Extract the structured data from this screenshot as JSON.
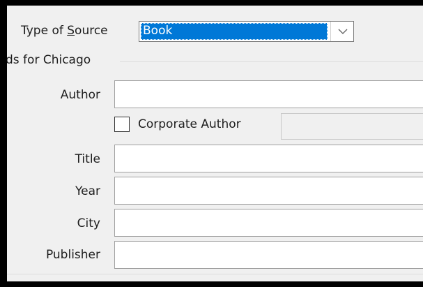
{
  "type_of_source": {
    "label_prefix": "Type of ",
    "label_mnemonic": "S",
    "label_suffix": "ource",
    "value": "Book"
  },
  "group": {
    "title": "ds for Chicago"
  },
  "fields": {
    "author": {
      "label": "Author",
      "value": ""
    },
    "corporate_author": {
      "label": "Corporate Author",
      "checked": false,
      "value": ""
    },
    "title": {
      "label": "Title",
      "value": ""
    },
    "year": {
      "label": "Year",
      "value": ""
    },
    "city": {
      "label": "City",
      "value": ""
    },
    "publisher": {
      "label": "Publisher",
      "value": ""
    }
  },
  "icons": {
    "dropdown": "chevron-down-icon"
  },
  "colors": {
    "selection": "#0078d7",
    "dialog_bg": "#f0f0f0",
    "outer_border": "#000000"
  }
}
